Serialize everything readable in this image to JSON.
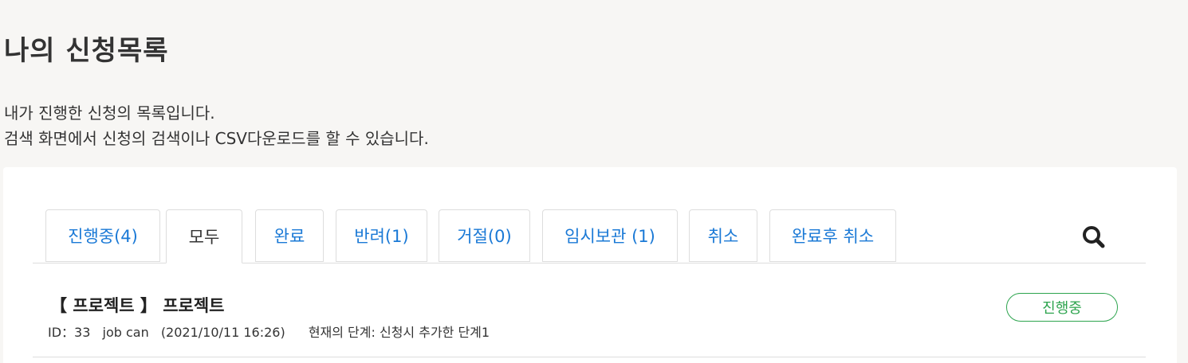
{
  "header": {
    "title": "나의 신청목록",
    "description_line1": "내가 진행한 신청의 목록입니다.",
    "description_line2": "검색 화면에서 신청의 검색이나 CSV다운로드를 할 수 있습니다."
  },
  "tabs": [
    {
      "label": "진행중(4)",
      "active": false
    },
    {
      "label": "모두",
      "active": true
    },
    {
      "label": "완료",
      "active": false
    },
    {
      "label": "반려(1)",
      "active": false
    },
    {
      "label": "거절(0)",
      "active": false
    },
    {
      "label": "임시보관 (1)",
      "active": false
    },
    {
      "label": "취소",
      "active": false
    },
    {
      "label": "완료후 취소",
      "active": false
    }
  ],
  "search": {
    "icon": "search-icon"
  },
  "items": [
    {
      "title": "【 프로젝트 】 프로젝트",
      "id": "ID：33",
      "applicant": "job can",
      "datetime": "(2021/10/11 16:26)",
      "stage": "현재의 단계: 신청시 추가한 단계1",
      "status": "진행중"
    }
  ],
  "colors": {
    "background": "#f7f6f4",
    "tab_link": "#1a79d6",
    "status_in_progress": "#2da44e"
  }
}
